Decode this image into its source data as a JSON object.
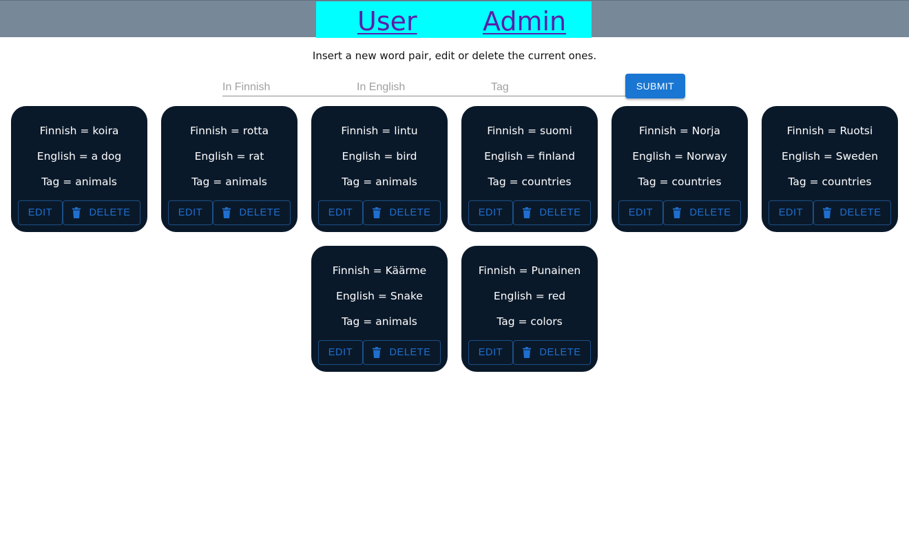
{
  "nav": {
    "user": "User",
    "admin": "Admin"
  },
  "instructions": "Insert a new word pair, edit or delete the current ones.",
  "form": {
    "finnish_placeholder": "In Finnish",
    "english_placeholder": "In English",
    "tag_placeholder": "Tag",
    "submit_label": "SUBMIT"
  },
  "buttons": {
    "edit": "EDIT",
    "delete": "DELETE"
  },
  "cards": [
    {
      "finnish": "Finnish = koira",
      "english": "English = a dog",
      "tag": "Tag = animals"
    },
    {
      "finnish": "Finnish = rotta",
      "english": "English = rat",
      "tag": "Tag = animals"
    },
    {
      "finnish": "Finnish = lintu",
      "english": "English = bird",
      "tag": "Tag = animals"
    },
    {
      "finnish": "Finnish = suomi",
      "english": "English = finland",
      "tag": "Tag = countries"
    },
    {
      "finnish": "Finnish = Norja",
      "english": "English = Norway",
      "tag": "Tag = countries"
    },
    {
      "finnish": "Finnish = Ruotsi",
      "english": "English = Sweden",
      "tag": "Tag = countries"
    },
    {
      "finnish": "Finnish = Käärme",
      "english": "English = Snake",
      "tag": "Tag = animals"
    },
    {
      "finnish": "Finnish = Punainen",
      "english": "English = red",
      "tag": "Tag = colors"
    }
  ],
  "colors": {
    "topbar": "#778899",
    "nav_bg": "#00ffff",
    "card_bg": "#0a192a",
    "accent": "#1976d2"
  }
}
